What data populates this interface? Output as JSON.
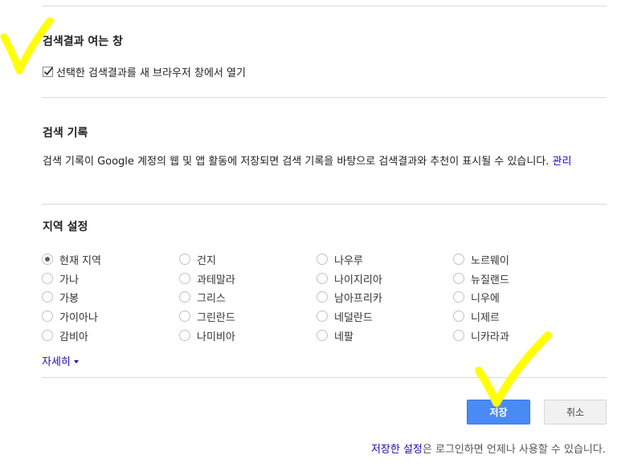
{
  "results_window": {
    "heading": "검색결과 여는 창",
    "checkbox_label": "선택한 검색결과를 새 브라우저 창에서 열기",
    "checked": true
  },
  "search_history": {
    "heading": "검색 기록",
    "description": "검색 기록이 Google 계정의 웹 및 앱 활동에 저장되면 검색 기록을 바탕으로 검색결과와 추천이 표시될 수 있습니다.",
    "manage_link": "관리"
  },
  "region": {
    "heading": "지역 설정",
    "columns": [
      [
        "현재 지역",
        "가나",
        "가봉",
        "가이아나",
        "감비아"
      ],
      [
        "건지",
        "과테말라",
        "그리스",
        "그린란드",
        "나미비아"
      ],
      [
        "나우루",
        "나이지리아",
        "남아프리카",
        "네덜란드",
        "네팔"
      ],
      [
        "노르웨이",
        "뉴질랜드",
        "니우에",
        "니제르",
        "니카라과"
      ]
    ],
    "selected": "현재 지역",
    "more_label": "자세히"
  },
  "buttons": {
    "save": "저장",
    "cancel": "취소"
  },
  "footer": {
    "link": "저장한 설정",
    "rest": "은 로그인하면 언제나 사용할 수 있습니다."
  },
  "colors": {
    "primary_button": "#4a8af4",
    "link": "#1a0dab",
    "annotation": "#ffff00"
  }
}
